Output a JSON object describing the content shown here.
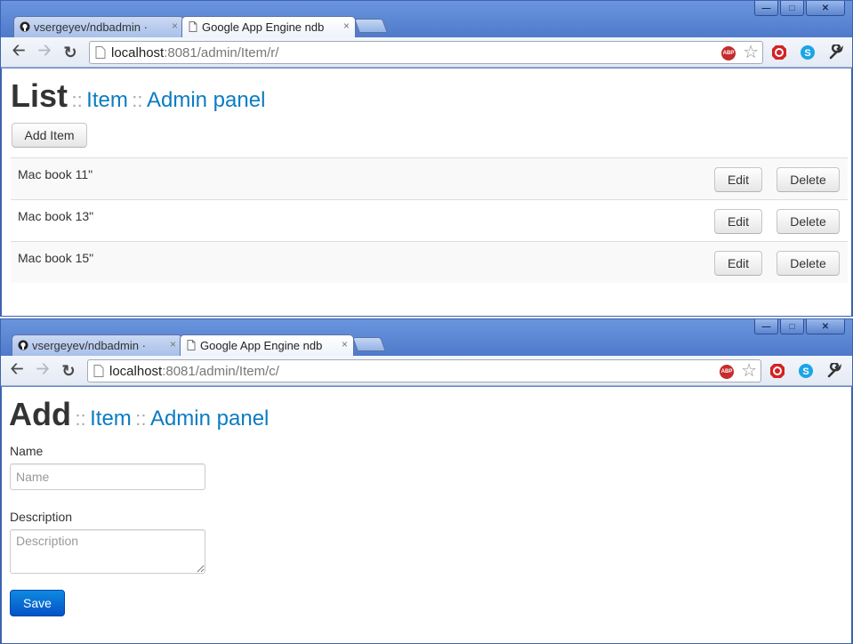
{
  "windows": [
    {
      "tabs": [
        {
          "title": "vsergeyev/ndbadmin ·",
          "active": false,
          "icon": "github-icon"
        },
        {
          "title": "Google App Engine ndb",
          "active": true,
          "icon": "page-icon"
        }
      ],
      "tab_close_glyph": "×",
      "url_host": "localhost",
      "url_rest": ":8081/admin/Item/r/",
      "abp_label": "ABP",
      "heading": "List",
      "sep": "::",
      "link_item": "Item",
      "link_admin": "Admin panel",
      "add_button": "Add Item",
      "rows": [
        {
          "name": "Mac book 11\"",
          "edit": "Edit",
          "delete": "Delete"
        },
        {
          "name": "Mac book 13\"",
          "edit": "Edit",
          "delete": "Delete"
        },
        {
          "name": "Mac book 15\"",
          "edit": "Edit",
          "delete": "Delete"
        }
      ]
    },
    {
      "tabs": [
        {
          "title": "vsergeyev/ndbadmin ·",
          "active": false,
          "icon": "github-icon"
        },
        {
          "title": "Google App Engine ndb",
          "active": true,
          "icon": "page-icon"
        }
      ],
      "tab_close_glyph": "×",
      "url_host": "localhost",
      "url_rest": ":8081/admin/Item/c/",
      "abp_label": "ABP",
      "heading": "Add",
      "sep": "::",
      "link_item": "Item",
      "link_admin": "Admin panel",
      "form": {
        "name_label": "Name",
        "name_placeholder": "Name",
        "name_value": "",
        "description_label": "Description",
        "description_placeholder": "Description",
        "description_value": "",
        "save_button": "Save"
      }
    }
  ],
  "colors": {
    "link": "#0b7cc2",
    "primary_button": "#0452c7",
    "window_frame": "#5b85d1"
  }
}
